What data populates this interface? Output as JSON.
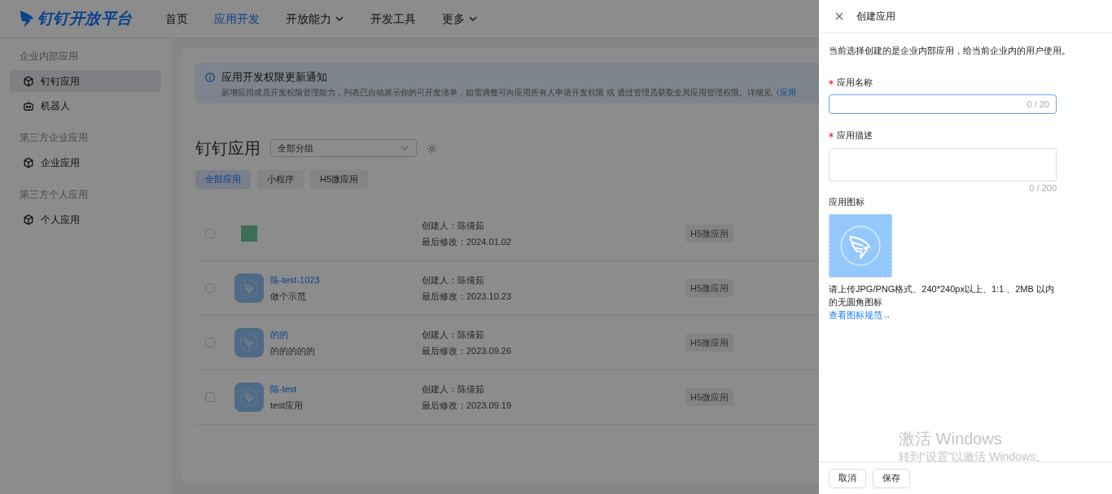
{
  "logo": {
    "text": "钉钉开放平台"
  },
  "nav": [
    {
      "label": "首页",
      "selected": false,
      "dropdown": false
    },
    {
      "label": "应用开发",
      "selected": true,
      "dropdown": false
    },
    {
      "label": "开放能力",
      "selected": false,
      "dropdown": true
    },
    {
      "label": "开发工具",
      "selected": false,
      "dropdown": false
    },
    {
      "label": "更多",
      "selected": false,
      "dropdown": true
    }
  ],
  "sidebar": {
    "groups": [
      {
        "title": "企业内部应用",
        "items": [
          {
            "label": "钉钉应用",
            "kind": "cube",
            "selected": true
          },
          {
            "label": "机器人",
            "kind": "robot",
            "selected": false
          }
        ]
      },
      {
        "title": "第三方企业应用",
        "items": [
          {
            "label": "企业应用",
            "kind": "cube",
            "selected": false
          }
        ]
      },
      {
        "title": "第三方个人应用",
        "items": [
          {
            "label": "个人应用",
            "kind": "cube",
            "selected": false
          }
        ]
      }
    ]
  },
  "notice": {
    "title": "应用开发权限更新通知",
    "text": "新增应用成员开发权限管理能力，列表已自动展示你的可开发清单，如需调整可向应用所有人申请开发权限 或 通过管理员获取全局应用管理权限。详细见",
    "link": "《应用"
  },
  "list_header": {
    "title": "钉钉应用",
    "group_select": {
      "value": "全部分组"
    }
  },
  "filters": [
    {
      "label": "全部应用",
      "selected": true
    },
    {
      "label": "小程序",
      "selected": false
    },
    {
      "label": "H5微应用",
      "selected": false
    }
  ],
  "apps": [
    {
      "checked": false,
      "kind": "color-block",
      "creator": "创建人：陈倩茹",
      "modified": "最后修改：2024.01.02",
      "tag": "H5微应用"
    },
    {
      "checked": false,
      "kind": "logo",
      "name": "陈-test-1023",
      "desc": "做个示范",
      "creator": "创建人：陈倩茹",
      "modified": "最后修改：2023.10.23",
      "tag": "H5微应用"
    },
    {
      "checked": false,
      "kind": "logo",
      "name": "的的",
      "desc": "的的的的的",
      "creator": "创建人：陈倩茹",
      "modified": "最后修改：2023.09.26",
      "tag": "H5微应用"
    },
    {
      "checked": false,
      "kind": "logo",
      "name": "陈-test",
      "desc": "test应用",
      "creator": "创建人：陈倩茹",
      "modified": "最后修改：2023.09.19",
      "tag": "H5微应用"
    }
  ],
  "drawer": {
    "title": "创建应用",
    "intro": "当前选择创建的是企业内部应用，给当前企业内的用户使用。",
    "name_field": {
      "label": "应用名称",
      "required": true,
      "counter": "0 / 20"
    },
    "desc_field": {
      "label": "应用描述",
      "required": true,
      "counter": "0 / 200"
    },
    "icon_field": {
      "label": "应用图标",
      "hint": "请上传JPG/PNG格式、240*240px以上、1:1 、2MB 以内的无圆角图标",
      "link": "查看图标规范→"
    },
    "buttons": [
      "取消",
      "保存"
    ]
  },
  "os_watermark": {
    "title": "激活 Windows",
    "text": "转到“设置”以激活 Windows。"
  }
}
